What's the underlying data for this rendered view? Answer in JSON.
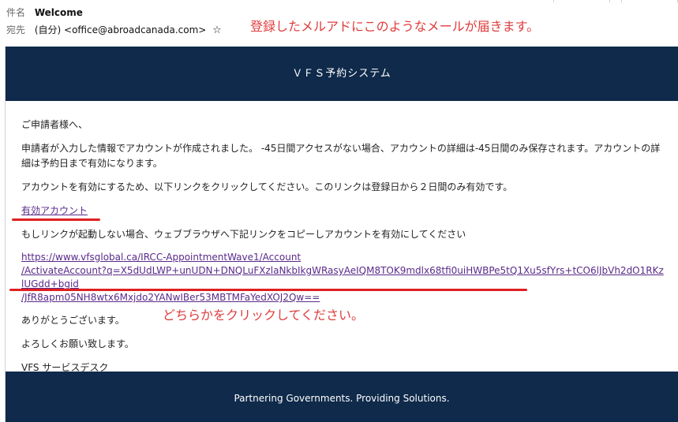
{
  "header": {
    "subject_label": "件名",
    "subject": "Welcome",
    "to_label": "宛先",
    "to_value": "(自分) <office@abroadcanada.com>",
    "star_icon": "star-icon"
  },
  "annotations": {
    "top": "登録したメルアドにこのようなメールが届きます。",
    "bottom": "どちらかをクリックしてください。"
  },
  "email": {
    "banner_title": "ＶＦＳ予約システム",
    "greeting": "ご申請者様へ、",
    "paragraph1": "申請者が入力した情報でアカウントが作成されました。 -45日間アクセスがない場合、アカウントの詳細は-45日間のみ保存されます。アカウントの詳細は予約日まで有効になります。",
    "paragraph2": "アカウントを有効にするため、以下リンクをクリックしてください。このリンクは登録日から２日間のみ有効です。",
    "activate_link_label": "有効アカウント",
    "paragraph3": "もしリンクが起動しない場合、ウェブブラウザへ下記リンクをコピーしアカウントを有効にしてください",
    "long_link_line1": "https://www.vfsglobal.ca/IRCC-AppointmentWave1/Account",
    "long_link_line2": "/ActivateAccount?q=X5dUdLWP+unUDN+DNQLuFXzlaNkbIkgWRasyAeIQM8TOK9mdlx68tfi0uiHWBPe5tQ1Xu5sfYrs+tCO6lJbVh2dO1RKzlUGdd+bgid",
    "long_link_line3": "/JfR8apm05NH8wtx6Mxjdo2YANwIBer53MBTMFaYedXOJ2Qw==",
    "thanks": "ありがとうございます。",
    "regards": "よろしくお願い致します。",
    "signature": "VFS サービスデスク",
    "footer": "Partnering Governments. Providing Solutions."
  },
  "colors": {
    "banner": "#0f2a4a",
    "annotation": "#e03c3c",
    "link": "#5a2a8a"
  }
}
